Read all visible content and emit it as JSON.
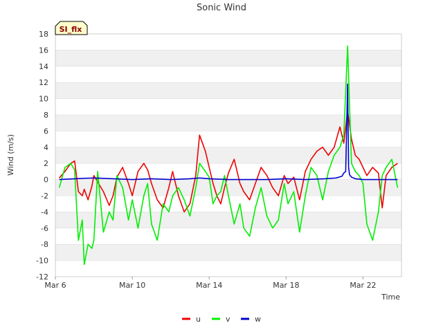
{
  "colors": {
    "u": "#ee0000",
    "v": "#00ee00",
    "w": "#0000cc",
    "band": "#f0f0f0",
    "grid": "#dddddd",
    "badge_bg": "#ffffcc"
  },
  "chart_data": {
    "type": "line",
    "title": "Sonic Wind",
    "badge": "SI_flx",
    "xlabel": "Time",
    "ylabel": "Wind (m/s)",
    "xlim": [
      "Mar 6",
      "Mar 24"
    ],
    "ylim": [
      -12,
      18
    ],
    "x_ticks": [
      "Mar 6",
      "Mar 10",
      "Mar 14",
      "Mar 18",
      "Mar 22"
    ],
    "y_ticks": [
      "-12",
      "-10",
      "-8",
      "-6",
      "-4",
      "-2",
      "0",
      "2",
      "4",
      "6",
      "8",
      "10",
      "12",
      "14",
      "16",
      "18"
    ],
    "grid": "horizontal bands",
    "legend": "bottom-center",
    "x_units": "days after Mar 6 00:00",
    "series": [
      {
        "name": "u",
        "x": [
          0.2,
          0.5,
          0.8,
          1.0,
          1.2,
          1.4,
          1.5,
          1.7,
          1.9,
          2.0,
          2.2,
          2.5,
          2.8,
          3.0,
          3.2,
          3.5,
          3.8,
          4.0,
          4.3,
          4.6,
          4.8,
          5.0,
          5.3,
          5.6,
          5.9,
          6.1,
          6.4,
          6.7,
          7.0,
          7.3,
          7.5,
          7.8,
          8.0,
          8.2,
          8.4,
          8.6,
          8.8,
          9.0,
          9.3,
          9.6,
          9.8,
          10.1,
          10.4,
          10.7,
          11.0,
          11.3,
          11.6,
          11.9,
          12.1,
          12.4,
          12.7,
          13.0,
          13.3,
          13.6,
          13.9,
          14.2,
          14.5,
          14.8,
          15.0,
          15.2,
          15.4,
          15.6,
          15.8,
          16.0,
          16.2,
          16.5,
          16.8,
          17.0,
          17.2,
          17.5,
          17.8
        ],
        "y": [
          0.2,
          1.0,
          2.0,
          2.3,
          -1.5,
          -2.0,
          -1.2,
          -2.5,
          -0.8,
          0.5,
          -0.3,
          -1.5,
          -3.2,
          -2.0,
          0.3,
          1.5,
          -0.5,
          -2.0,
          1.0,
          2.0,
          1.2,
          -0.5,
          -2.5,
          -3.5,
          -1.0,
          1.0,
          -2.0,
          -4.0,
          -3.0,
          0.5,
          5.5,
          3.5,
          1.5,
          -0.5,
          -2.0,
          -3.0,
          -1.0,
          0.8,
          2.5,
          -0.5,
          -1.5,
          -2.5,
          -0.5,
          1.5,
          0.5,
          -1.0,
          -2.0,
          0.5,
          -0.5,
          0.3,
          -2.5,
          1.0,
          2.5,
          3.5,
          4.0,
          3.0,
          4.0,
          6.5,
          4.5,
          8.5,
          5.0,
          3.0,
          2.5,
          1.5,
          0.5,
          1.5,
          0.8,
          -3.5,
          0.5,
          1.5,
          2.0
        ]
      },
      {
        "name": "v",
        "x": [
          0.2,
          0.5,
          0.8,
          1.0,
          1.2,
          1.4,
          1.5,
          1.7,
          1.9,
          2.0,
          2.2,
          2.5,
          2.8,
          3.0,
          3.2,
          3.5,
          3.8,
          4.0,
          4.3,
          4.6,
          4.8,
          5.0,
          5.3,
          5.6,
          5.9,
          6.1,
          6.4,
          6.7,
          7.0,
          7.3,
          7.5,
          7.8,
          8.0,
          8.2,
          8.4,
          8.6,
          8.8,
          9.0,
          9.3,
          9.6,
          9.8,
          10.1,
          10.4,
          10.7,
          11.0,
          11.3,
          11.6,
          11.9,
          12.1,
          12.4,
          12.7,
          13.0,
          13.3,
          13.6,
          13.9,
          14.2,
          14.5,
          14.8,
          15.0,
          15.2,
          15.4,
          15.6,
          15.8,
          16.0,
          16.2,
          16.5,
          16.8,
          17.0,
          17.2,
          17.5,
          17.8
        ],
        "y": [
          -1.0,
          1.5,
          2.0,
          1.2,
          -7.5,
          -5.0,
          -10.5,
          -8.0,
          -8.5,
          -7.5,
          1.0,
          -6.5,
          -4.0,
          -5.0,
          0.5,
          -1.0,
          -5.0,
          -2.5,
          -6.0,
          -2.0,
          -0.5,
          -5.5,
          -7.5,
          -3.0,
          -4.0,
          -2.0,
          -1.0,
          -2.5,
          -4.5,
          -1.0,
          2.0,
          1.0,
          0.3,
          -3.0,
          -2.0,
          -1.5,
          0.5,
          -2.0,
          -5.5,
          -3.0,
          -6.0,
          -7.0,
          -3.5,
          -1.0,
          -4.5,
          -6.0,
          -5.0,
          -0.5,
          -3.0,
          -1.5,
          -6.5,
          -2.0,
          1.5,
          0.5,
          -2.5,
          1.0,
          3.0,
          4.0,
          5.5,
          16.5,
          2.0,
          1.0,
          0.5,
          -0.5,
          -5.5,
          -7.5,
          -4.0,
          0.5,
          1.5,
          2.5,
          -1.0
        ]
      },
      {
        "name": "w",
        "x": [
          0.2,
          1.0,
          2.0,
          3.0,
          4.0,
          5.0,
          6.0,
          7.0,
          7.5,
          8.0,
          9.0,
          10.0,
          11.0,
          12.0,
          13.0,
          14.0,
          14.6,
          14.9,
          15.0,
          15.1,
          15.2,
          15.25,
          15.3,
          15.4,
          15.6,
          16.0,
          17.0,
          17.8
        ],
        "y": [
          0.0,
          0.1,
          0.2,
          0.1,
          0.0,
          0.1,
          0.0,
          0.1,
          0.2,
          0.1,
          0.0,
          0.0,
          0.0,
          0.1,
          0.0,
          0.1,
          0.2,
          0.4,
          0.8,
          1.0,
          11.8,
          1.5,
          0.6,
          0.3,
          0.1,
          0.0,
          0.0,
          0.0
        ]
      }
    ]
  }
}
